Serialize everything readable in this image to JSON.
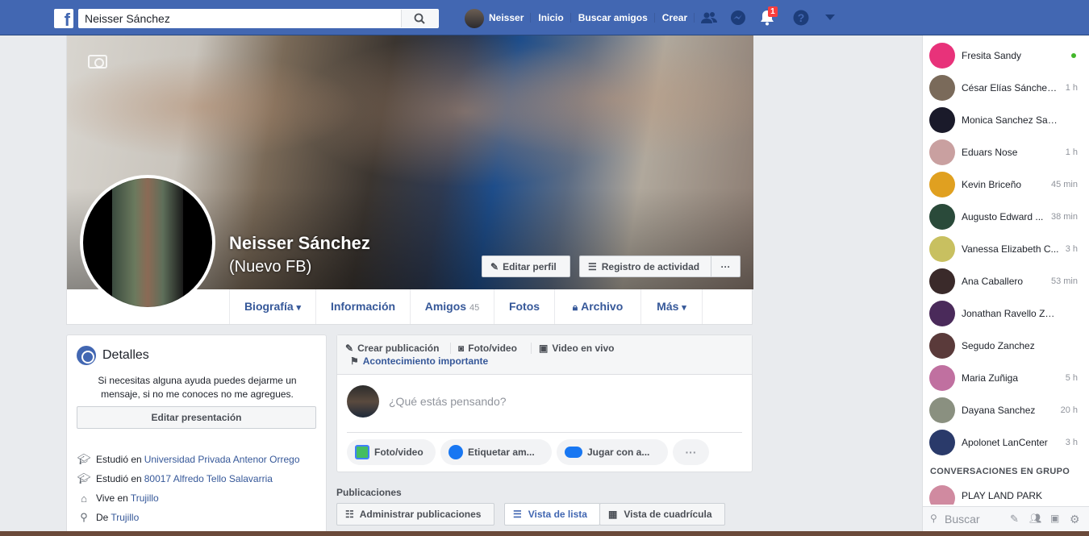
{
  "topbar": {
    "logo": "f",
    "search_value": "Neisser Sánchez",
    "user_name": "Neisser",
    "nav_links": [
      "Inicio",
      "Buscar amigos",
      "Crear"
    ],
    "notification_count": "1"
  },
  "profile": {
    "name": "Neisser Sánchez",
    "alternate_name": "(Nuevo FB)",
    "edit_profile": "Editar perfil",
    "activity_log": "Registro de actividad",
    "more": "···",
    "tabs": [
      {
        "label": "Biografía",
        "suffix": "▾"
      },
      {
        "label": "Información"
      },
      {
        "label": "Amigos",
        "count": "45"
      },
      {
        "label": "Fotos"
      },
      {
        "label": "Archivo"
      },
      {
        "label": "Más",
        "suffix": "▾"
      }
    ]
  },
  "details": {
    "title": "Detalles",
    "bio": "Si necesitas alguna ayuda puedes dejarme un mensaje, si no me conoces no me agregues.",
    "edit_button": "Editar presentación",
    "rows": [
      {
        "prefix": "Estudió en",
        "link": "Universidad Privada Antenor Orrego"
      },
      {
        "prefix": "Estudió en",
        "link": "80017 Alfredo Tello Salavarria"
      },
      {
        "prefix": "Vive en",
        "link": "Trujillo"
      },
      {
        "prefix": "De",
        "link": "Trujillo"
      }
    ]
  },
  "composer": {
    "create_post": "Crear publicación",
    "photo_video": "Foto/video",
    "live_video": "Video en vivo",
    "life_event": "Acontecimiento importante",
    "placeholder": "¿Qué estás pensando?",
    "actions": [
      "Foto/video",
      "Etiquetar am...",
      "Jugar con a...",
      "···"
    ]
  },
  "posts": {
    "label": "Publicaciones",
    "manage": "Administrar publicaciones",
    "list_view": "Vista de lista",
    "grid_view": "Vista de cuadrícula"
  },
  "chat": {
    "contacts": [
      {
        "name": "Fresita Sandy",
        "time": "",
        "online": true,
        "color": "#e8327a"
      },
      {
        "name": "César Elías Sánchez...",
        "time": "1 h",
        "color": "#7a6a5a"
      },
      {
        "name": "Monica Sanchez Sabedra",
        "time": "",
        "color": "#1a1a2a"
      },
      {
        "name": "Eduars Nose",
        "time": "1 h",
        "color": "#c9a0a0"
      },
      {
        "name": "Kevin Briceño",
        "time": "45 min",
        "color": "#e0a020"
      },
      {
        "name": "Augusto Edward ...",
        "time": "38 min",
        "color": "#2a4a3a"
      },
      {
        "name": "Vanessa Elizabeth C...",
        "time": "3 h",
        "color": "#c8c060"
      },
      {
        "name": "Ana Caballero",
        "time": "53 min",
        "color": "#3a2a2a"
      },
      {
        "name": "Jonathan Ravello Zurita",
        "time": "",
        "color": "#4a2a5a"
      },
      {
        "name": "Segudo Zanchez",
        "time": "",
        "color": "#5a3a3a"
      },
      {
        "name": "Maria Zuñiga",
        "time": "5 h",
        "color": "#c070a0"
      },
      {
        "name": "Dayana Sanchez",
        "time": "20 h",
        "color": "#8a9080"
      },
      {
        "name": "Apolonet LanCenter",
        "time": "3 h",
        "color": "#2a3a6a"
      }
    ],
    "group_title": "CONVERSACIONES EN GRUPO",
    "group": {
      "name": "PLAY LAND PARK"
    },
    "search_placeholder": "Buscar"
  },
  "colors": {
    "brand": "#4267b2",
    "link": "#365899",
    "background": "#e9ebee"
  }
}
